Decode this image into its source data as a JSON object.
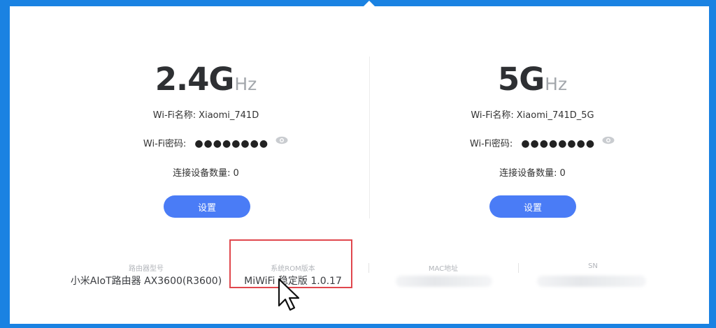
{
  "bands": [
    {
      "big": "2.4G",
      "unit": "Hz",
      "wifi_name_label": "Wi-Fi名称:",
      "wifi_name": "Xiaomi_741D",
      "wifi_password_label": "Wi-Fi密码:",
      "wifi_password_mask": "●●●●●●●●",
      "devices_label": "连接设备数量:",
      "devices_count": "0",
      "settings_label": "设置"
    },
    {
      "big": "5G",
      "unit": "Hz",
      "wifi_name_label": "Wi-Fi名称:",
      "wifi_name": "Xiaomi_741D_5G",
      "wifi_password_label": "Wi-Fi密码:",
      "wifi_password_mask": "●●●●●●●●",
      "devices_label": "连接设备数量:",
      "devices_count": "0",
      "settings_label": "设置"
    }
  ],
  "info": {
    "router_model_label": "路由器型号",
    "router_model_value": "小米AIoT路由器 AX3600(R3600)",
    "rom_version_label": "系统ROM版本",
    "rom_version_value": "MiWiFi 稳定版 1.0.17",
    "mac_label": "MAC地址",
    "sn_label": "SN"
  },
  "colors": {
    "frame_blue": "#1a82e2",
    "button_blue": "#4a7cf6",
    "highlight_red": "#e0474d"
  },
  "icons": {
    "password_toggle": "eye-icon",
    "pointer": "mouse-cursor-icon"
  }
}
